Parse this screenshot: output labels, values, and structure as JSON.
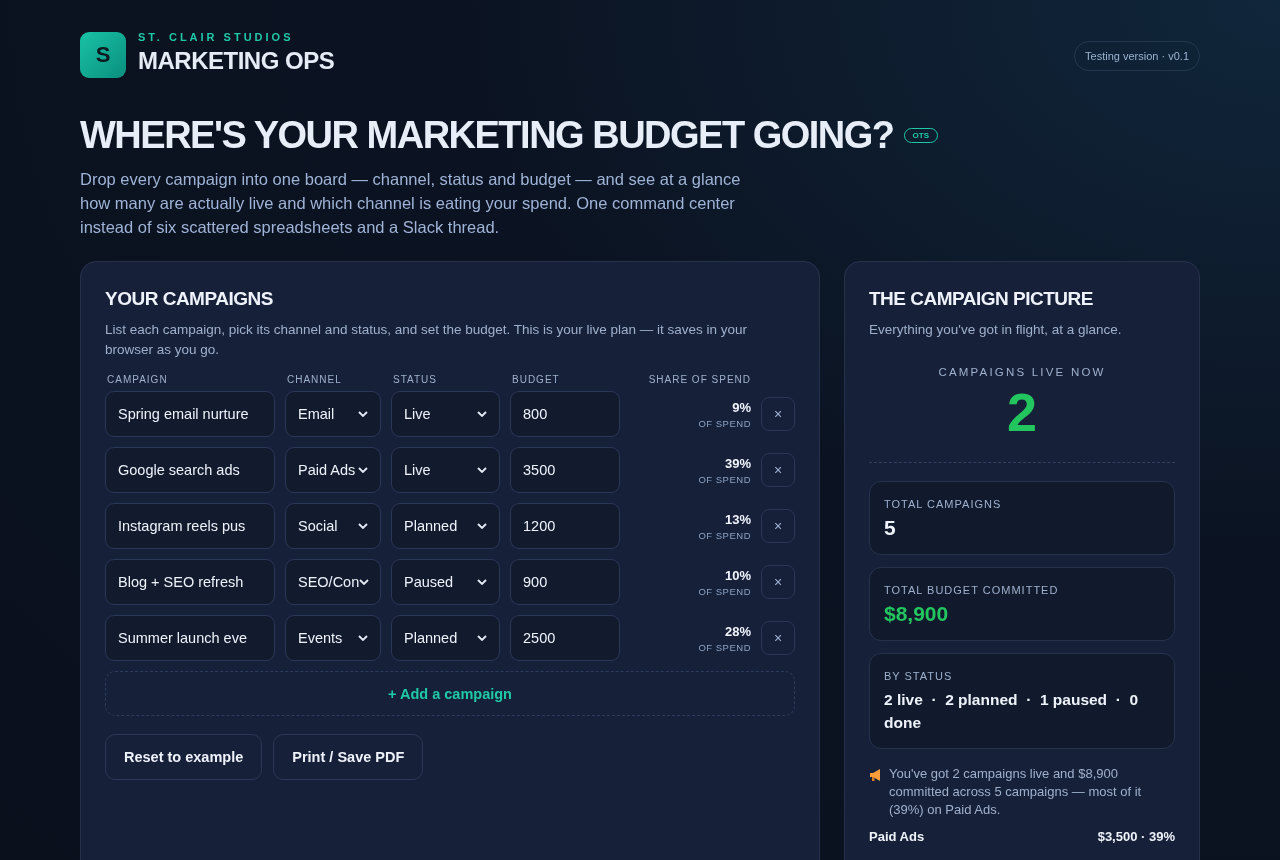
{
  "brand": {
    "logo_letter": "S",
    "studio": "ST. CLAIR STUDIOS",
    "product": "MARKETING OPS"
  },
  "version_badge": "Testing version · v0.1",
  "hero": {
    "title": "WHERE'S YOUR MARKETING BUDGET GOING?",
    "tag": "OTS",
    "intro": "Drop every campaign into one board — channel, status and budget — and see at a glance how many are actually live and which channel is eating your spend. One command center instead of six scattered spreadsheets and a Slack thread."
  },
  "campaigns": {
    "title": "YOUR CAMPAIGNS",
    "description": "List each campaign, pick its channel and status, and set the budget. This is your live plan — it saves in your browser as you go.",
    "columns": [
      "CAMPAIGN",
      "CHANNEL",
      "STATUS",
      "BUDGET",
      "SHARE OF SPEND"
    ],
    "rows": [
      {
        "name": "Spring email nurture",
        "channel": "Email",
        "status": "Live",
        "budget": "800",
        "share": "9%",
        "share_label": "OF SPEND",
        "remove": "×"
      },
      {
        "name": "Google search ads",
        "channel": "Paid Ads",
        "status": "Live",
        "budget": "3500",
        "share": "39%",
        "share_label": "OF SPEND",
        "remove": "×"
      },
      {
        "name": "Instagram reels pus",
        "channel": "Social",
        "status": "Planned",
        "budget": "1200",
        "share": "13%",
        "share_label": "OF SPEND",
        "remove": "×"
      },
      {
        "name": "Blog + SEO refresh",
        "channel": "SEO/Con",
        "status": "Paused",
        "budget": "900",
        "share": "10%",
        "share_label": "OF SPEND",
        "remove": "×"
      },
      {
        "name": "Summer launch eve",
        "channel": "Events",
        "status": "Planned",
        "budget": "2500",
        "share": "28%",
        "share_label": "OF SPEND",
        "remove": "×"
      }
    ],
    "add_button": "+ Add a campaign",
    "buttons": [
      "Reset to example",
      "Print / Save PDF"
    ]
  },
  "summary": {
    "title": "THE CAMPAIGN PICTURE",
    "subtitle": "Everything you've got in flight, at a glance.",
    "live_label": "CAMPAIGNS LIVE NOW",
    "live_count": "2",
    "stats": [
      {
        "kind": "count",
        "label": "TOTAL CAMPAIGNS",
        "value": "5"
      },
      {
        "kind": "money",
        "label": "TOTAL BUDGET COMMITTED",
        "value": "$8,900"
      },
      {
        "kind": "status",
        "label": "BY STATUS",
        "value": "2 live  ·  2 planned  ·  1 paused  ·  0 done"
      }
    ],
    "note": "You've got 2 campaigns live and $8,900 committed across 5 campaigns — most of it (39%) on Paid Ads.",
    "breakdown": [
      {
        "label": "Paid Ads",
        "value": "$3,500 · 39%"
      }
    ]
  }
}
